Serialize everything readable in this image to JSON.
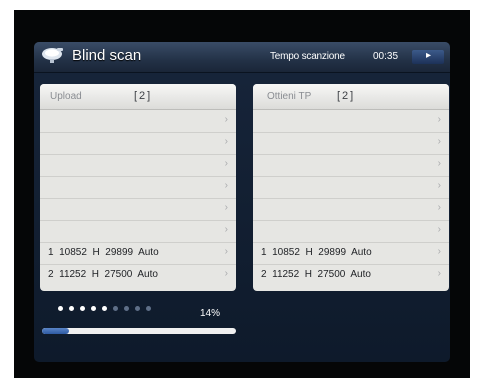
{
  "header": {
    "title": "Blind scan",
    "scan_label": "Tempo scanzione",
    "scan_time": "00:35"
  },
  "left_panel": {
    "name": "Upload",
    "count": "[2]",
    "results": [
      "1  10852  H  29899  Auto",
      "2  11252  H  27500  Auto"
    ]
  },
  "right_panel": {
    "name": "Ottieni TP",
    "count": "[2]",
    "results": [
      "1  10852  H  29899  Auto",
      "2  11252  H  27500  Auto"
    ]
  },
  "progress": {
    "percent_text": "14%",
    "fraction": 0.14,
    "dots_total": 9,
    "dots_lit": 5
  },
  "colors": {
    "dot_on": "#ffffff",
    "dot_off": "#5f6f88"
  },
  "icons": {
    "logo": "satellite-dish-icon",
    "row_chevron": "chevron-right-icon",
    "corner_button": "arrow-icon"
  }
}
